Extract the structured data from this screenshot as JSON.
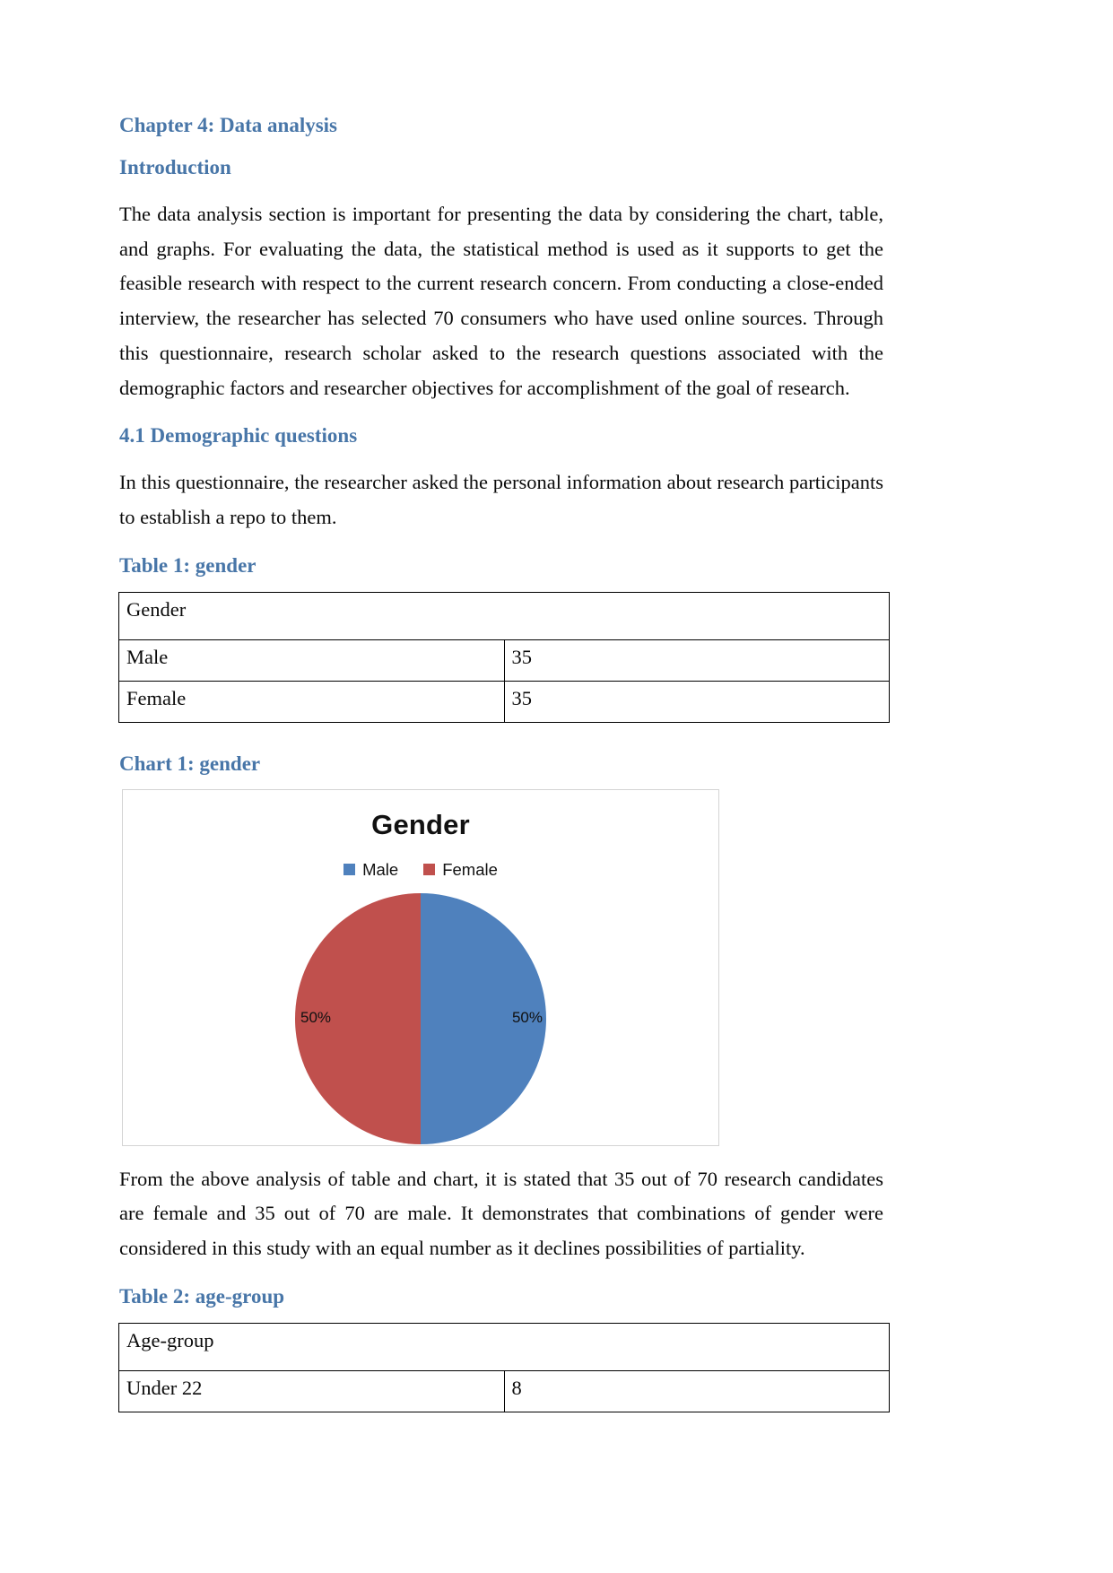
{
  "document": {
    "headings": {
      "chapter": "Chapter 4: Data analysis",
      "introduction": "Introduction",
      "section_41": "4.1 Demographic questions",
      "table1_caption": "Table 1: gender",
      "chart1_caption": "Chart 1: gender",
      "table2_caption": "Table 2: age-group"
    },
    "paragraphs": {
      "intro": "The data analysis section is important for presenting the data by considering the chart, table, and graphs. For evaluating the data, the statistical method is used as it supports to get the feasible research with respect to the current research concern. From conducting a close-ended interview, the researcher has selected 70 consumers who have used online sources. Through this questionnaire, research scholar asked to the research questions associated with the demographic factors and researcher objectives for accomplishment of the goal of research.",
      "section_41_body": "In this questionnaire, the researcher asked the personal information about research participants to establish a repo to them.",
      "after_chart": "From the above analysis of table and chart, it is stated that 35 out of 70 research candidates are female and 35 out of 70 are male. It demonstrates that combinations of gender were considered in this study with an equal number as it declines possibilities of partiality."
    },
    "table1": {
      "header": "Gender",
      "rows": [
        {
          "label": "Male",
          "value": "35"
        },
        {
          "label": "Female",
          "value": "35"
        }
      ]
    },
    "table2": {
      "header": "Age-group",
      "rows": [
        {
          "label": "Under 22",
          "value": "8"
        }
      ]
    },
    "colors": {
      "heading_blue": "#4876a8",
      "male_blue": "#4F81BD",
      "female_red": "#C0504D",
      "table_border": "#000000",
      "chart_border": "#d4d4d4"
    }
  },
  "chart_data": {
    "type": "pie",
    "title": "Gender",
    "categories": [
      "Male",
      "Female"
    ],
    "values": [
      50,
      50
    ],
    "counts": [
      35,
      35
    ],
    "data_labels": [
      "50%",
      "50%"
    ],
    "legend": [
      {
        "name": "Male",
        "color": "#4F81BD"
      },
      {
        "name": "Female",
        "color": "#C0504D"
      }
    ],
    "legend_position": "top",
    "grid": false,
    "xlabel": "",
    "ylabel": ""
  }
}
